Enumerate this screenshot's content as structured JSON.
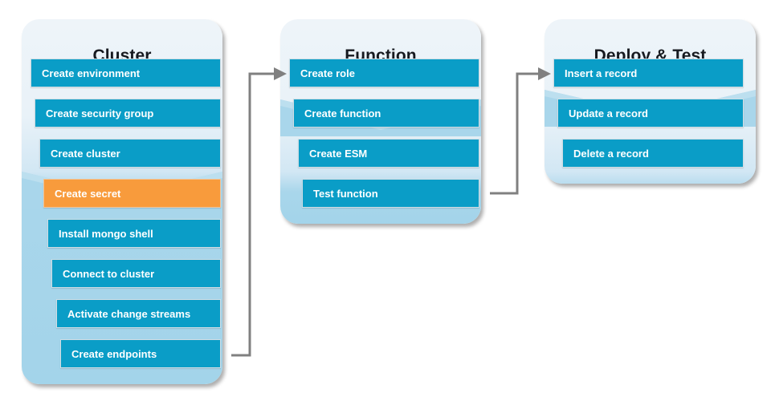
{
  "diagram": {
    "title_hidden": "",
    "colors": {
      "step_blue": "#0a9dc7",
      "step_highlight_orange": "#f89b3c",
      "panel_top": "#eef4f9",
      "panel_bottom": "#a3d4ea",
      "connector_gray": "#808080",
      "title_text": "#16191f",
      "step_text": "#ffffff"
    },
    "columns": [
      {
        "id": "cluster",
        "title": "Cluster",
        "steps": [
          {
            "label": "Create environment",
            "state": "normal"
          },
          {
            "label": "Create security group",
            "state": "normal"
          },
          {
            "label": "Create cluster",
            "state": "normal"
          },
          {
            "label": "Create secret",
            "state": "highlight"
          },
          {
            "label": "Install mongo shell",
            "state": "normal"
          },
          {
            "label": "Connect to cluster",
            "state": "normal"
          },
          {
            "label": "Activate change streams",
            "state": "normal"
          },
          {
            "label": "Create endpoints",
            "state": "normal"
          }
        ]
      },
      {
        "id": "function",
        "title": "Function",
        "steps": [
          {
            "label": "Create role",
            "state": "normal"
          },
          {
            "label": "Create function",
            "state": "normal"
          },
          {
            "label": "Create ESM",
            "state": "normal"
          },
          {
            "label": "Test function",
            "state": "normal"
          }
        ]
      },
      {
        "id": "deploy-test",
        "title": "Deploy & Test",
        "steps": [
          {
            "label": "Insert a record",
            "state": "normal"
          },
          {
            "label": "Update a record",
            "state": "normal"
          },
          {
            "label": "Delete a record",
            "state": "normal"
          }
        ]
      }
    ],
    "connectors": [
      {
        "id": "cluster-to-function",
        "from": "cluster",
        "to": "function"
      },
      {
        "id": "function-to-deploy-test",
        "from": "function",
        "to": "deploy-test"
      }
    ]
  }
}
